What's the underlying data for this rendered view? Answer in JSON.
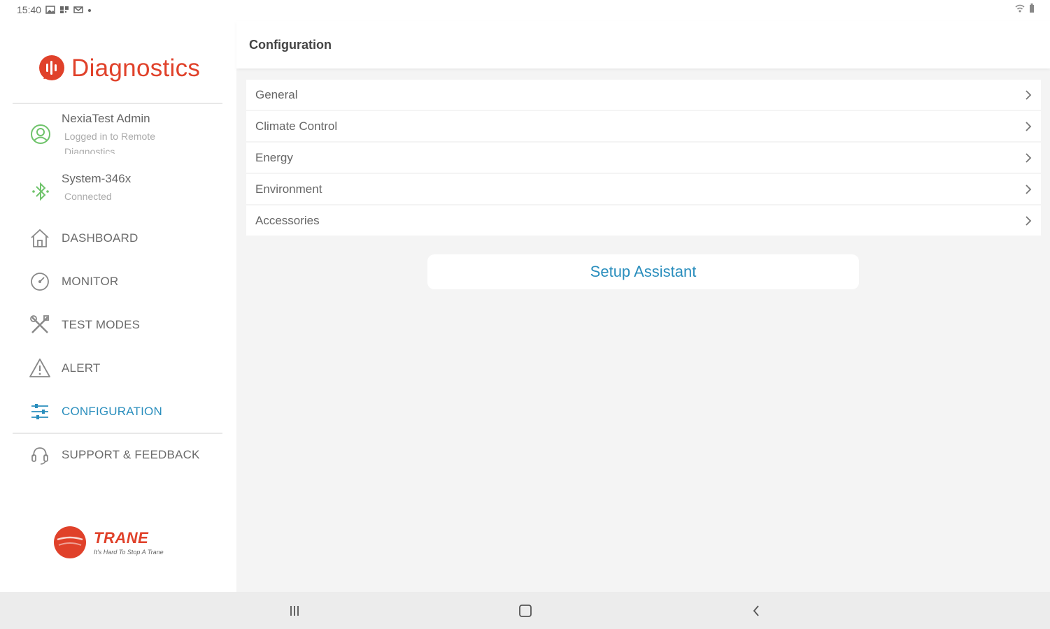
{
  "status_bar": {
    "time": "15:40",
    "icons": [
      "gallery-icon",
      "qr-icon",
      "mail-icon",
      "dot-icon"
    ],
    "right_icons": [
      "wifi-icon",
      "battery-icon"
    ]
  },
  "sidebar": {
    "brand_title": "Diagnostics",
    "user": {
      "name": "NexiaTest Admin",
      "status": "Logged in to Remote Diagnostics"
    },
    "system": {
      "name": "System-346x",
      "status": "Connected"
    },
    "nav": [
      {
        "label": "DASHBOARD",
        "icon": "home-icon"
      },
      {
        "label": "MONITOR",
        "icon": "gauge-icon"
      },
      {
        "label": "TEST MODES",
        "icon": "tools-icon"
      },
      {
        "label": "ALERT",
        "icon": "warning-icon"
      },
      {
        "label": "CONFIGURATION",
        "icon": "sliders-icon",
        "active": true
      },
      {
        "label": "SUPPORT & FEEDBACK",
        "icon": "headset-icon"
      }
    ],
    "logo": {
      "word": "TRANE",
      "tagline": "It's Hard To Stop A Trane"
    }
  },
  "header": {
    "title": "Configuration"
  },
  "menu": [
    {
      "label": "General"
    },
    {
      "label": "Climate Control"
    },
    {
      "label": "Energy"
    },
    {
      "label": "Environment"
    },
    {
      "label": "Accessories"
    }
  ],
  "setup_button": "Setup Assistant",
  "colors": {
    "accent": "#2a8ebd",
    "brand": "#e0412a",
    "icon_green": "#6fc36b"
  }
}
